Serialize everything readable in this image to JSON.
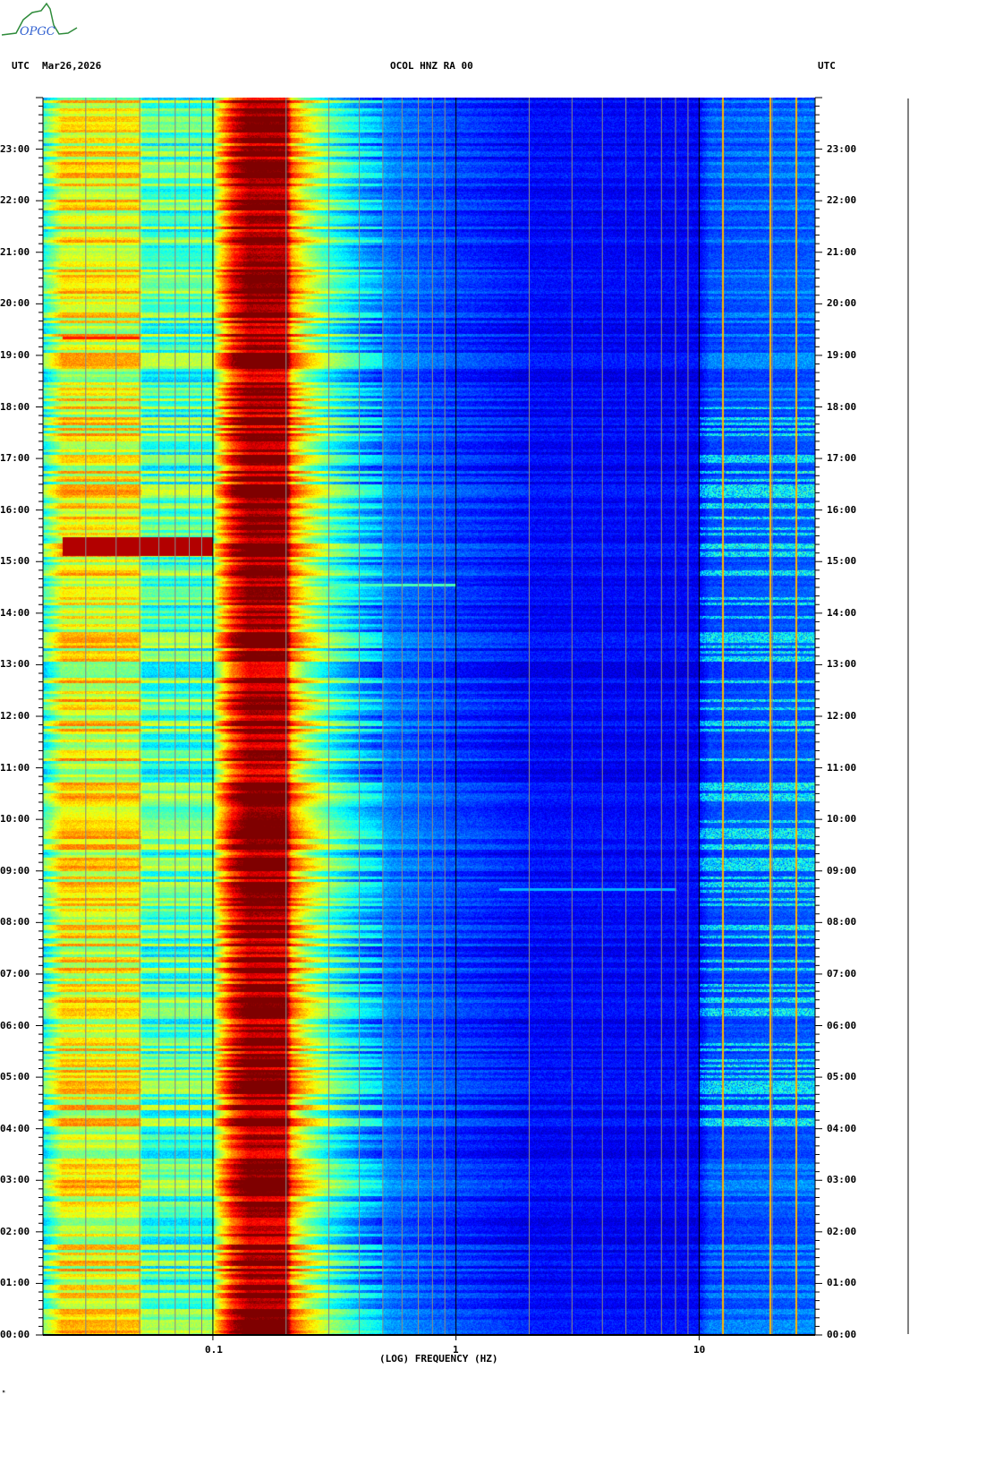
{
  "header": {
    "left_tz": "UTC",
    "date": "Mar26,2026",
    "station": "OCOL HNZ RA 00",
    "right_tz": "UTC"
  },
  "logo_text": "OPGC",
  "footer_mark": "ᴹ",
  "colors": {
    "grid_minor": "#888888",
    "grid_major": "#000000",
    "axis": "#000000"
  },
  "chart_data": {
    "type": "heatmap",
    "title": "OCOL HNZ RA 00",
    "xlabel": "(LOG) FREQUENCY (HZ)",
    "ylabel": "UTC",
    "xscale": "log",
    "xlim": [
      0.02,
      30
    ],
    "ylim_hours": [
      0,
      24
    ],
    "x_tick_labels": [
      {
        "value": 0.1,
        "label": "0.1"
      },
      {
        "value": 1,
        "label": "1"
      },
      {
        "value": 10,
        "label": "10"
      }
    ],
    "y_tick_labels": [
      "00:00",
      "01:00",
      "02:00",
      "03:00",
      "04:00",
      "05:00",
      "06:00",
      "07:00",
      "08:00",
      "09:00",
      "10:00",
      "11:00",
      "12:00",
      "13:00",
      "14:00",
      "15:00",
      "16:00",
      "17:00",
      "18:00",
      "19:00",
      "20:00",
      "21:00",
      "22:00",
      "23:00"
    ],
    "colormap": "jet",
    "frequency_profile": [
      [
        0.02,
        0.42
      ],
      [
        0.024,
        0.62
      ],
      [
        0.05,
        0.6
      ],
      [
        0.051,
        0.46
      ],
      [
        0.1,
        0.45
      ],
      [
        0.102,
        0.58
      ],
      [
        0.12,
        0.86
      ],
      [
        0.14,
        1.0
      ],
      [
        0.2,
        0.98
      ],
      [
        0.21,
        0.74
      ],
      [
        0.24,
        0.6
      ],
      [
        0.3,
        0.45
      ],
      [
        0.4,
        0.33
      ],
      [
        0.55,
        0.24
      ],
      [
        1.0,
        0.18
      ],
      [
        2.0,
        0.13
      ],
      [
        10.0,
        0.12
      ],
      [
        11,
        0.2
      ],
      [
        30,
        0.22
      ]
    ],
    "events": [
      {
        "utc_hour": 15.3,
        "duration_h": 0.35,
        "fmin": 0.024,
        "fmax": 0.1,
        "level": 0.95
      },
      {
        "utc_hour": 19.35,
        "duration_h": 0.06,
        "fmin": 0.024,
        "fmax": 0.05,
        "level": 0.85
      },
      {
        "utc_hour": 14.55,
        "duration_h": 0.06,
        "fmin": 0.3,
        "fmax": 1.0,
        "level": 0.45
      },
      {
        "utc_hour": 8.65,
        "duration_h": 0.05,
        "fmin": 1.5,
        "fmax": 8,
        "level": 0.3
      }
    ],
    "persistent_lines_hz": [
      12.5,
      19.5,
      25
    ]
  }
}
